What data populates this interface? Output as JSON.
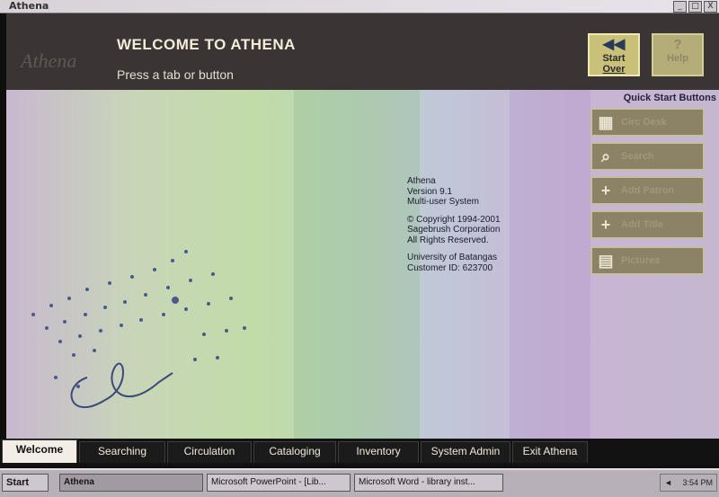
{
  "window": {
    "title": "Athena",
    "controls": [
      "_",
      "□",
      "X"
    ]
  },
  "header": {
    "welcome": "WELCOME TO ATHENA",
    "subtitle": "Press a tab or button",
    "start_over": {
      "line1": "Start",
      "line2": "Over"
    },
    "help": "Help"
  },
  "about": {
    "line1": "Athena",
    "line2": "Version 9.1",
    "line3": "Multi-user System",
    "line4": "© Copyright 1994-2001",
    "line5": "Sagebrush Corporation",
    "line6": "All Rights Reserved.",
    "line7": "University of Batangas",
    "line8": "Customer ID: 623700"
  },
  "quick_start": {
    "title": "Quick Start Buttons",
    "buttons": [
      {
        "label": "Circ Desk",
        "icon": "circ-desk-icon"
      },
      {
        "label": "Search",
        "icon": "search-icon"
      },
      {
        "label": "Add Patron",
        "icon": "plus-icon"
      },
      {
        "label": "Add Title",
        "icon": "plus-icon"
      },
      {
        "label": "Pictures",
        "icon": "printer-icon"
      }
    ]
  },
  "tabs": [
    "Welcome",
    "Searching",
    "Circulation",
    "Cataloging",
    "Inventory",
    "System Admin",
    "Exit Athena"
  ],
  "taskbar": {
    "start": "Start",
    "items": [
      "Athena",
      "Microsoft PowerPoint - [Lib...",
      "Microsoft Word - library inst..."
    ],
    "clock": "3:54 PM"
  },
  "colors": {
    "header_bg": "#3a3434",
    "button_bg": "#8c8266",
    "active_tab": "#f2eee6"
  }
}
